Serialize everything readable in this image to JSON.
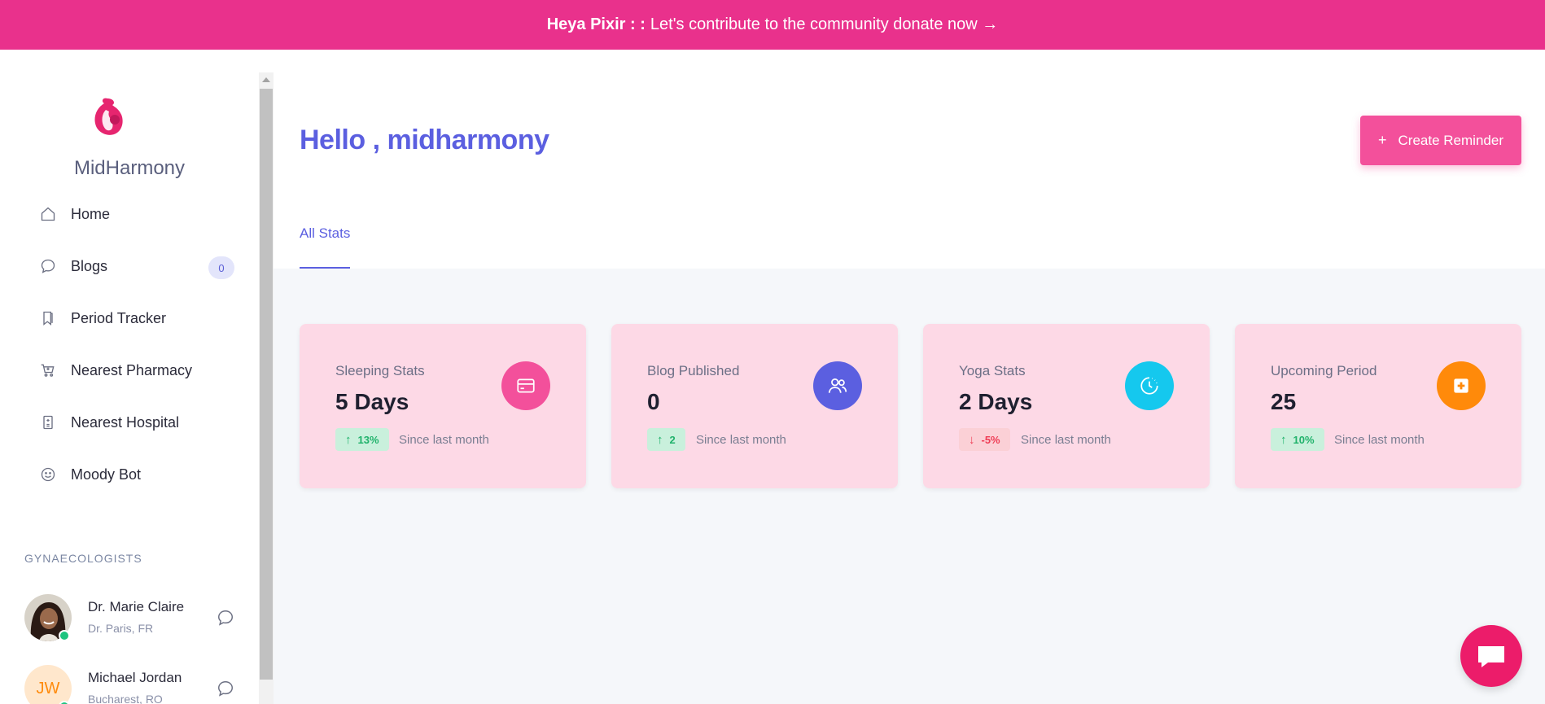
{
  "banner": {
    "bold": "Heya Pixir : :",
    "text": "Let's contribute to the community donate now →"
  },
  "sidebar": {
    "brand": "MidHarmony",
    "items": [
      {
        "label": "Home",
        "icon": "home-icon"
      },
      {
        "label": "Blogs",
        "icon": "message-icon",
        "badge": "0"
      },
      {
        "label": "Period Tracker",
        "icon": "bookmark-icon"
      },
      {
        "label": "Nearest Pharmacy",
        "icon": "cart-icon"
      },
      {
        "label": "Nearest Hospital",
        "icon": "hospital-icon"
      },
      {
        "label": "Moody Bot",
        "icon": "smile-icon"
      }
    ],
    "section_title": "GYNAECOLOGISTS",
    "doctors": [
      {
        "name": "Dr. Marie Claire",
        "location": "Dr. Paris, FR"
      },
      {
        "name": "Michael Jordan",
        "location": "Bucharest, RO",
        "initials": "JW"
      }
    ]
  },
  "header": {
    "greeting": "Hello , midharmony",
    "create_label": "Create Reminder",
    "tab": "All Stats"
  },
  "stats": [
    {
      "title": "Sleeping Stats",
      "value": "5 Days",
      "change": "13%",
      "direction": "up",
      "since": "Since last month",
      "icon": "card-icon",
      "color": "#f3509b"
    },
    {
      "title": "Blog Published",
      "value": "0",
      "change": "2",
      "direction": "up",
      "since": "Since last month",
      "icon": "users-icon",
      "color": "#5b5fe0"
    },
    {
      "title": "Yoga Stats",
      "value": "2 Days",
      "change": "-5%",
      "direction": "down",
      "since": "Since last month",
      "icon": "clock-icon",
      "color": "#15c8ee"
    },
    {
      "title": "Upcoming Period",
      "value": "25",
      "change": "10%",
      "direction": "up",
      "since": "Since last month",
      "icon": "first-aid-icon",
      "color": "#ff8a0a"
    }
  ],
  "colors": {
    "banner": "#e9318c",
    "accent": "#5b5fe0",
    "card_bg": "#fdd9e6",
    "chat_fab": "#ec1c6a"
  }
}
